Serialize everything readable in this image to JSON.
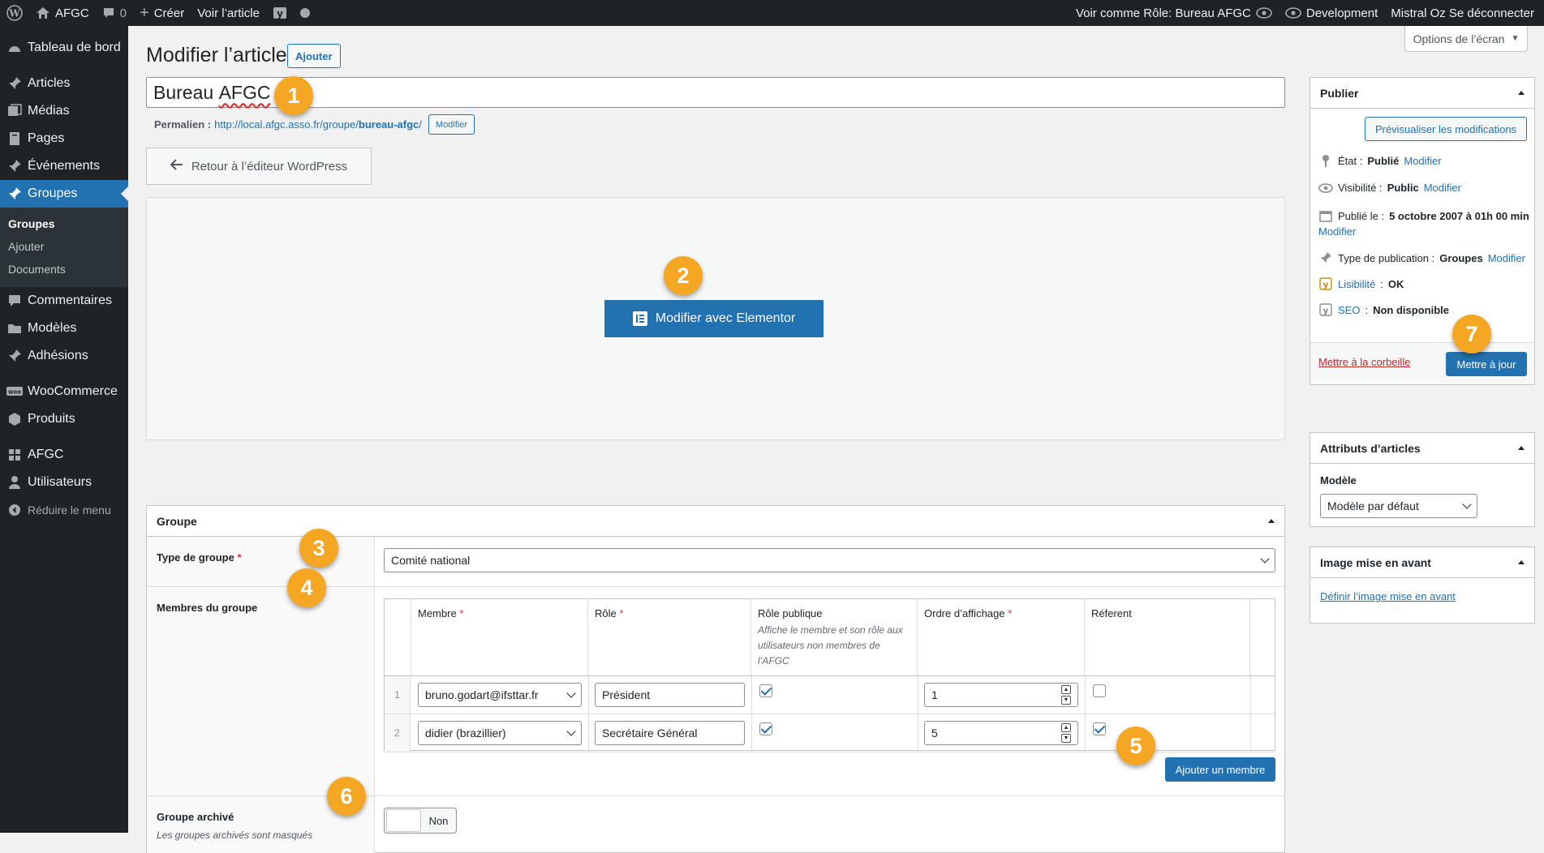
{
  "admin_bar": {
    "site_name": "AFGC",
    "comments_count": "0",
    "create_label": "Créer",
    "view_post_label": "Voir l’article",
    "view_as_label": "Voir comme Rôle: Bureau AFGC",
    "environment_label": "Development",
    "user_label": "Mistral Oz Se déconnecter"
  },
  "sidebar": {
    "items": [
      {
        "label": "Tableau de bord",
        "icon": "dashboard-icon"
      },
      {
        "label": "Articles",
        "icon": "pin-icon"
      },
      {
        "label": "Médias",
        "icon": "media-icon"
      },
      {
        "label": "Pages",
        "icon": "pages-icon"
      },
      {
        "label": "Événements",
        "icon": "pin-icon"
      },
      {
        "label": "Groupes",
        "icon": "pin-icon",
        "current": true
      },
      {
        "label": "Commentaires",
        "icon": "comment-icon"
      },
      {
        "label": "Modèles",
        "icon": "folder-icon"
      },
      {
        "label": "Adhésions",
        "icon": "pin-icon"
      },
      {
        "label": "WooCommerce",
        "icon": "woo-icon"
      },
      {
        "label": "Produits",
        "icon": "box-icon"
      },
      {
        "label": "AFGC",
        "icon": "grid-icon"
      },
      {
        "label": "Utilisateurs",
        "icon": "user-icon"
      }
    ],
    "submenu": [
      "Groupes",
      "Ajouter",
      "Documents"
    ],
    "collapse_label": "Réduire le menu"
  },
  "page": {
    "title": "Modifier l’article",
    "add_button": "Ajouter",
    "screen_options": "Options de l’écran",
    "post_title": "Bureau AFGC",
    "post_title_first": "Bureau",
    "post_title_second": "AFGC",
    "permalink_label": "Permalien :",
    "permalink_base": "http://local.afgc.asso.fr/groupe/",
    "permalink_slug": "bureau-afgc",
    "permalink_end": "/",
    "permalink_edit": "Modifier",
    "back_button": "Retour à l’éditeur WordPress",
    "elementor_button": "Modifier avec Elementor"
  },
  "groupe": {
    "title": "Groupe",
    "type_label": "Type de groupe",
    "required_mark": "*",
    "type_value": "Comité national",
    "members_label": "Membres du groupe",
    "columns": {
      "member": "Membre",
      "role": "Rôle",
      "public_role": "Rôle publique",
      "public_role_desc": "Affiche le membre et son rôle aux utilisateurs non membres de l’AFGC",
      "order": "Ordre d’affichage",
      "referent": "Réferent"
    },
    "rows": [
      {
        "num": "1",
        "member": "bruno.godart@ifsttar.fr",
        "role": "Président",
        "public": true,
        "order": "1",
        "referent": false
      },
      {
        "num": "2",
        "member": "didier (brazillier)",
        "role": "Secrétaire Général",
        "public": true,
        "order": "5",
        "referent": true
      }
    ],
    "add_member_button": "Ajouter un membre",
    "archived_label": "Groupe archivé",
    "archived_desc": "Les groupes archivés sont masqués",
    "archived_value": "Non"
  },
  "publish": {
    "title": "Publier",
    "preview_button": "Prévisualiser les modifications",
    "status_label": "État :",
    "status_value": "Publié",
    "visibility_label": "Visibilité :",
    "visibility_value": "Public",
    "published_label": "Publié le :",
    "published_value": "5 octobre 2007 à 01h 00 min",
    "type_label": "Type de publication :",
    "type_value": "Groupes",
    "edit_link": "Modifier",
    "readability_label": "Lisibilité",
    "readability_value": "OK",
    "seo_label": "SEO",
    "seo_value": "Non disponible",
    "trash_link": "Mettre à la corbeille",
    "update_button": "Mettre à jour"
  },
  "attributes": {
    "title": "Attributs d’articles",
    "model_label": "Modèle",
    "model_value": "Modèle par défaut"
  },
  "featured_image": {
    "title": "Image mise en avant",
    "set_link": "Définir l’image mise en avant"
  },
  "badges": [
    "1",
    "2",
    "3",
    "4",
    "5",
    "6",
    "7"
  ],
  "colors": {
    "admin_dark": "#1d2327",
    "accent_blue": "#2271b1",
    "badge_orange": "#f5a623",
    "trash_red": "#b32d2e"
  }
}
